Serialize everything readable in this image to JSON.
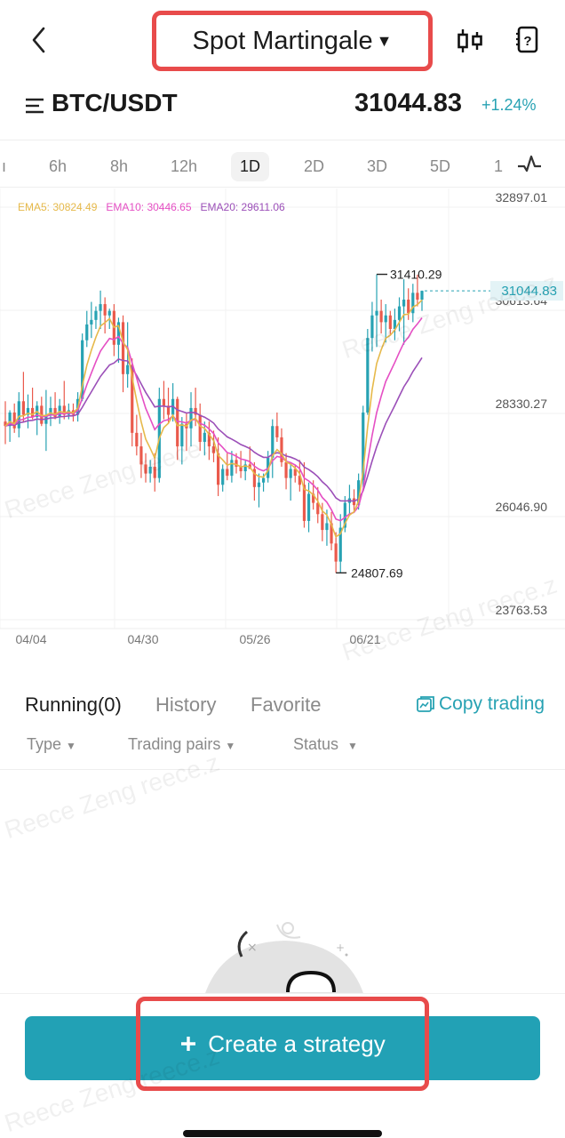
{
  "header": {
    "title": "Spot Martingale",
    "title_caret": "▼",
    "back_icon": "chevron-left-icon",
    "right_icons": [
      "candlestick-chart-icon",
      "help-book-icon"
    ]
  },
  "pair_bar": {
    "pair": "BTC/USDT",
    "price": "31044.83",
    "change": "+1.24%",
    "change_color": "#27a2b3"
  },
  "intervals": {
    "items": [
      "6h",
      "8h",
      "12h",
      "1D",
      "2D",
      "3D",
      "5D",
      "1"
    ],
    "active": "1D",
    "partial_left": "ı",
    "indicator_icon": "pulse-icon"
  },
  "ema_legend": {
    "ema5": "EMA5: 30824.49",
    "ema10": "EMA10: 30446.65",
    "ema20": "EMA20: 29611.06",
    "colors": {
      "ema5": "#e6b94a",
      "ema10": "#e54fc4",
      "ema20": "#9b4fb8"
    }
  },
  "chart_data": {
    "type": "candlestick",
    "title": "",
    "xlabel": "",
    "ylabel": "",
    "y_ticks": [
      "32897.01",
      "30613.64",
      "28330.27",
      "26046.90",
      "23763.53"
    ],
    "ylim": [
      23763.53,
      32897.01
    ],
    "x_ticks": [
      "04/04",
      "04/30",
      "05/26",
      "06/21"
    ],
    "current_price_label": "31044.83",
    "high_marker": "31410.29",
    "low_marker": "24807.69",
    "up_color": "#27a2b3",
    "down_color": "#ea5a4c",
    "candles": [
      [
        28150,
        28600,
        27650,
        28050
      ],
      [
        28050,
        28400,
        27700,
        28350
      ],
      [
        28350,
        28550,
        27900,
        28000
      ],
      [
        28000,
        28800,
        27800,
        28600
      ],
      [
        28600,
        29250,
        28150,
        28300
      ],
      [
        28300,
        28750,
        28000,
        28450
      ],
      [
        28450,
        28900,
        28200,
        28250
      ],
      [
        28250,
        28600,
        27850,
        28500
      ],
      [
        28500,
        28700,
        28050,
        28100
      ],
      [
        28100,
        28850,
        27500,
        28300
      ],
      [
        28300,
        28700,
        28050,
        28450
      ],
      [
        28450,
        28800,
        28200,
        28250
      ],
      [
        28250,
        28650,
        28100,
        28500
      ],
      [
        28500,
        29050,
        28200,
        28300
      ],
      [
        28300,
        28550,
        28200,
        28400
      ],
      [
        28400,
        28550,
        28150,
        28300
      ],
      [
        28300,
        28800,
        28150,
        28650
      ],
      [
        28650,
        30100,
        28600,
        29950
      ],
      [
        29950,
        30600,
        29800,
        30300
      ],
      [
        30300,
        30800,
        30000,
        30400
      ],
      [
        30400,
        30700,
        30200,
        30600
      ],
      [
        30600,
        31050,
        30200,
        30750
      ],
      [
        30750,
        30900,
        30100,
        30500
      ],
      [
        30500,
        30650,
        30200,
        30600
      ],
      [
        30600,
        30750,
        29600,
        29850
      ],
      [
        29850,
        30450,
        29450,
        30350
      ],
      [
        30350,
        30500,
        28800,
        29200
      ],
      [
        29200,
        30350,
        28900,
        29400
      ],
      [
        29400,
        29550,
        27600,
        27900
      ],
      [
        27900,
        28300,
        27400,
        27600
      ],
      [
        27600,
        27900,
        26900,
        27200
      ],
      [
        27200,
        27450,
        26800,
        27000
      ],
      [
        27000,
        27300,
        26800,
        27150
      ],
      [
        27150,
        27450,
        26600,
        26900
      ],
      [
        26900,
        28900,
        26800,
        28650
      ],
      [
        28650,
        29050,
        28200,
        28500
      ],
      [
        28500,
        28900,
        28100,
        28300
      ],
      [
        28300,
        29000,
        28150,
        28650
      ],
      [
        28650,
        28700,
        27300,
        27600
      ],
      [
        27600,
        28250,
        27200,
        28100
      ],
      [
        28100,
        28350,
        27500,
        28000
      ],
      [
        28000,
        28800,
        27600,
        28450
      ],
      [
        28450,
        28900,
        28050,
        28300
      ],
      [
        28300,
        28550,
        27500,
        27700
      ],
      [
        27700,
        28150,
        27400,
        27900
      ],
      [
        27900,
        28150,
        27300,
        27600
      ],
      [
        27600,
        27950,
        27250,
        27450
      ],
      [
        27450,
        27800,
        26500,
        26750
      ],
      [
        26750,
        27200,
        26600,
        27100
      ],
      [
        27100,
        27450,
        26850,
        26950
      ],
      [
        26950,
        27500,
        26800,
        27300
      ],
      [
        27300,
        27450,
        27000,
        27150
      ],
      [
        27150,
        27500,
        26900,
        27050
      ],
      [
        27050,
        27300,
        26850,
        27200
      ],
      [
        27200,
        27600,
        27100,
        27100
      ],
      [
        27100,
        27250,
        26400,
        26700
      ],
      [
        26700,
        27000,
        26250,
        26800
      ],
      [
        26800,
        27000,
        26600,
        26900
      ],
      [
        26900,
        27500,
        26800,
        27350
      ],
      [
        27350,
        28200,
        26900,
        28050
      ],
      [
        28050,
        28350,
        27700,
        27800
      ],
      [
        27800,
        28000,
        27150,
        27250
      ],
      [
        27250,
        27450,
        26650,
        26900
      ],
      [
        26900,
        27250,
        26400,
        27100
      ],
      [
        27100,
        27200,
        26800,
        26950
      ],
      [
        26950,
        27300,
        26600,
        26750
      ],
      [
        26750,
        27250,
        25800,
        25950
      ],
      [
        25950,
        26800,
        25700,
        26550
      ],
      [
        26550,
        26850,
        26200,
        26350
      ],
      [
        26350,
        26700,
        25900,
        26100
      ],
      [
        26100,
        26350,
        25500,
        25750
      ],
      [
        25750,
        26200,
        25400,
        25900
      ],
      [
        25900,
        26150,
        25300,
        25450
      ],
      [
        25450,
        25700,
        24800,
        25050
      ],
      [
        25050,
        26100,
        24808,
        25800
      ],
      [
        25800,
        26500,
        25700,
        26350
      ],
      [
        26350,
        26750,
        26100,
        26450
      ],
      [
        26450,
        26650,
        26150,
        26300
      ],
      [
        26300,
        27000,
        26200,
        26850
      ],
      [
        26850,
        28500,
        26700,
        28350
      ],
      [
        28350,
        30200,
        28300,
        30000
      ],
      [
        30000,
        30800,
        29700,
        30500
      ],
      [
        30500,
        31410,
        29800,
        30600
      ],
      [
        30600,
        30850,
        30100,
        30350
      ],
      [
        30350,
        30750,
        29900,
        30500
      ],
      [
        30500,
        30600,
        30050,
        30200
      ],
      [
        30200,
        30650,
        29950,
        30400
      ],
      [
        30400,
        30900,
        30150,
        30700
      ],
      [
        30700,
        31300,
        29850,
        30850
      ],
      [
        30850,
        31100,
        30400,
        30550
      ],
      [
        30550,
        31200,
        30350,
        31000
      ],
      [
        31000,
        31400,
        30700,
        30850
      ],
      [
        30850,
        31050,
        30600,
        31044.83
      ]
    ]
  },
  "tabs": {
    "items": [
      "Running(0)",
      "History",
      "Favorite"
    ],
    "active": "Running(0)",
    "copy_trading": "Copy trading"
  },
  "filters": {
    "items": [
      "Type",
      "Trading pairs",
      "Status"
    ],
    "caret": "▼"
  },
  "actions": {
    "create_label": "Create a strategy",
    "create_icon": "plus-icon"
  },
  "watermark": "Reece Zeng reece.z"
}
